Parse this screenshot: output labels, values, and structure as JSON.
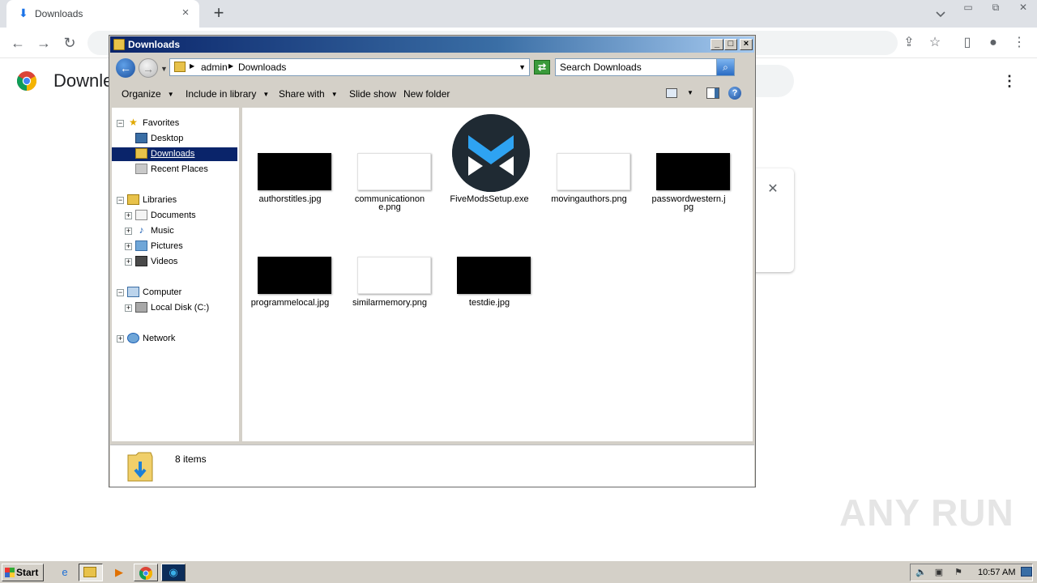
{
  "browser": {
    "tab_title": "Downloads",
    "tab_close_icon": "×",
    "new_tab_icon": "+",
    "page_title": "Downle",
    "card_close_icon": "✕",
    "kebab_icon": "⋮"
  },
  "explorer": {
    "title": "Downloads",
    "breadcrumbs": [
      "admin",
      "Downloads"
    ],
    "search_placeholder": "Search Downloads",
    "toolbar": {
      "organize": "Organize",
      "include": "Include in library",
      "share": "Share with",
      "slideshow": "Slide show",
      "new_folder": "New folder"
    },
    "nav": {
      "favorites": "Favorites",
      "desktop": "Desktop",
      "downloads": "Downloads",
      "recent": "Recent Places",
      "libraries": "Libraries",
      "documents": "Documents",
      "music": "Music",
      "pictures": "Pictures",
      "videos": "Videos",
      "computer": "Computer",
      "local_disk": "Local Disk (C:)",
      "network": "Network"
    },
    "files": [
      {
        "name": "authorstitles.jpg"
      },
      {
        "name": "communicationone.png"
      },
      {
        "name": "FiveModsSetup.exe"
      },
      {
        "name": "movingauthors.png"
      },
      {
        "name": "passwordwestern.jpg"
      },
      {
        "name": "programmelocal.jpg"
      },
      {
        "name": "similarmemory.png"
      },
      {
        "name": "testdie.jpg"
      }
    ],
    "status": "8 items"
  },
  "taskbar": {
    "start": "Start",
    "clock": "10:57 AM"
  },
  "watermark": "ANY RUN",
  "colors": {
    "titlebar_start": "#0a246a",
    "titlebar_end": "#a6caf0",
    "selection": "#0a246a",
    "fivem_blue": "#2ea3f2"
  }
}
